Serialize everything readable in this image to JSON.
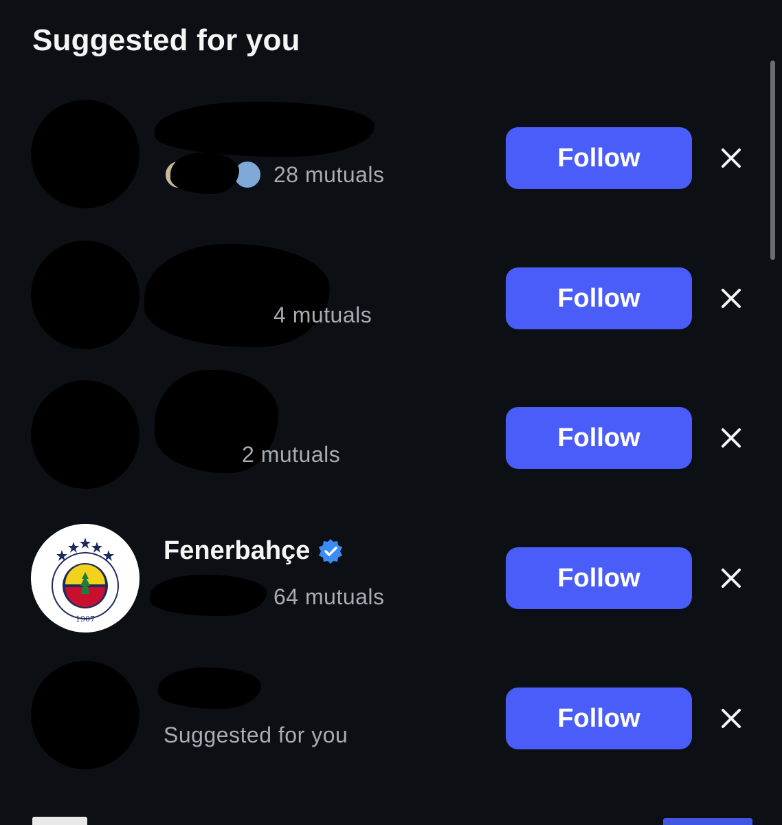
{
  "header": {
    "title": "Suggested for you"
  },
  "colors": {
    "background": "#0c1014",
    "follow_button": "#4a5df9",
    "verified_badge": "#3b8cf5",
    "secondary_text": "#a8acb3"
  },
  "suggestions": [
    {
      "name": "",
      "subtitle": "28 mutuals",
      "follow_label": "Follow",
      "dismiss_icon": "close-icon",
      "redacted": true
    },
    {
      "name": "",
      "subtitle": "4 mutuals",
      "follow_label": "Follow",
      "dismiss_icon": "close-icon",
      "redacted": true
    },
    {
      "name": "",
      "subtitle": "2 mutuals",
      "follow_label": "Follow",
      "dismiss_icon": "close-icon",
      "redacted": true
    },
    {
      "name": "Fenerbahçe",
      "verified": true,
      "subtitle": "64 mutuals",
      "follow_label": "Follow",
      "dismiss_icon": "close-icon",
      "logo_text": "FENERBAHÇE SPOR KULÜBÜ",
      "logo_year": "1907"
    },
    {
      "name": "",
      "subtitle": "Suggested for you",
      "follow_label": "Follow",
      "dismiss_icon": "close-icon",
      "redacted": true
    }
  ]
}
